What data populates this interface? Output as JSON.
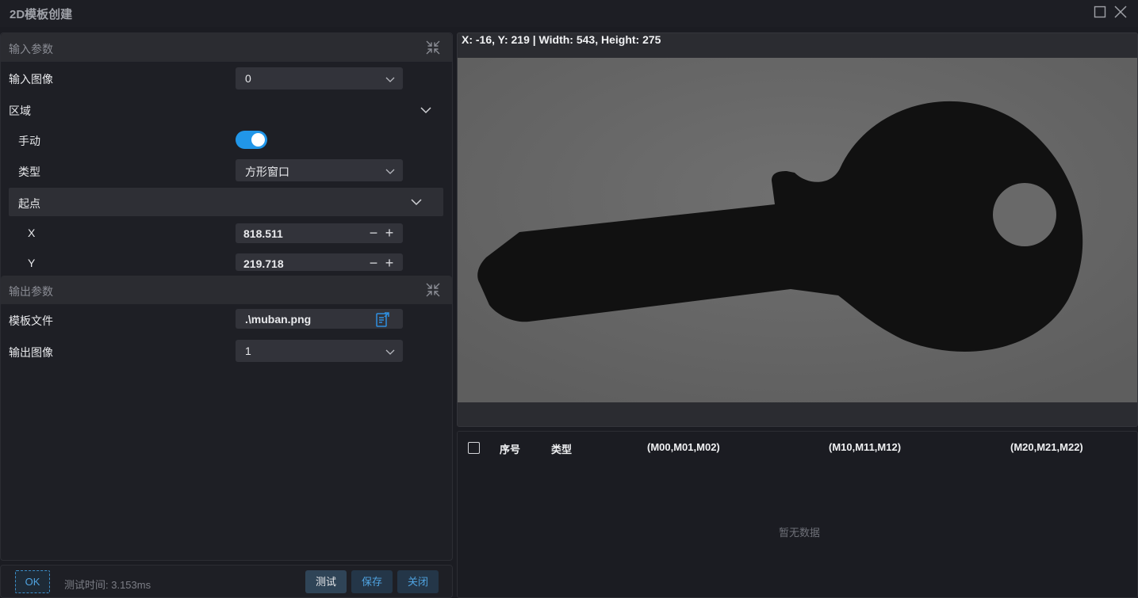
{
  "window": {
    "title": "2D模板创建"
  },
  "input_section": {
    "title": "输入参数",
    "input_image": {
      "label": "输入图像",
      "value": "0"
    },
    "region": {
      "label": "区域"
    },
    "manual": {
      "label": "手动",
      "enabled": true
    },
    "type": {
      "label": "类型",
      "value": "方形窗口"
    },
    "start_point": {
      "label": "起点",
      "x": {
        "label": "X",
        "value": "818.511"
      },
      "y": {
        "label": "Y",
        "value": "219.718"
      }
    }
  },
  "output_section": {
    "title": "输出参数",
    "template_file": {
      "label": "模板文件",
      "value": ".\\muban.png"
    },
    "output_image": {
      "label": "输出图像",
      "value": "1"
    }
  },
  "footer": {
    "ok_label": "OK",
    "test_time": "测试时间: 3.153ms",
    "test_label": "测试",
    "save_label": "保存",
    "close_label": "关闭"
  },
  "viewer": {
    "coord_readout": "X: -16, Y: 219 | Width: 543, Height: 275"
  },
  "table": {
    "columns": [
      "序号",
      "类型",
      "(M00,M01,M02)",
      "(M10,M11,M12)",
      "(M20,M21,M22)"
    ],
    "empty_text": "暂无数据"
  },
  "colors": {
    "accent": "#2196e8",
    "background": "#1b1c22",
    "panel": "#1e1f25"
  }
}
